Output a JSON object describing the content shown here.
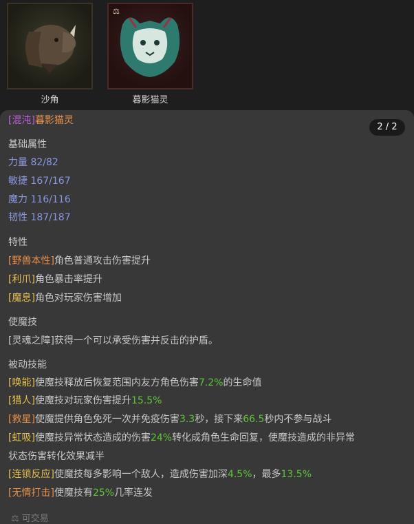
{
  "items": [
    {
      "name": "沙角"
    },
    {
      "name": "暮影猫灵"
    }
  ],
  "tooltip": {
    "tag": "[混沌]",
    "title": "暮影猫灵",
    "counter": "2 / 2",
    "base_header": "基础属性",
    "stats": [
      {
        "label": "力量",
        "value": "82/82"
      },
      {
        "label": "敏捷",
        "value": "167/167"
      },
      {
        "label": "魔力",
        "value": "116/116"
      },
      {
        "label": "韧性",
        "value": "187/187"
      }
    ],
    "trait_header": "特性",
    "traits": [
      {
        "tag": "[野兽本性]",
        "text": "角色普通攻击伤害提升"
      },
      {
        "tag": "[利爪]",
        "text": "角色暴击率提升"
      },
      {
        "tag": "[魔息]",
        "text": "角色对玩家伤害增加"
      }
    ],
    "skill_header": "使魔技",
    "skill_text": "[灵魂之障]获得一个可以承受伤害并反击的护盾。",
    "passive_header": "被动技能",
    "passives": {
      "p1": {
        "tag": "[唤能]",
        "a": "使魔技释放后恢复范围内友方角色伤害",
        "v1": "7.2%",
        "b": "的生命值"
      },
      "p2": {
        "tag": "[猎人]",
        "a": "使魔技对玩家伤害提升",
        "v1": "15.5%"
      },
      "p3": {
        "tag": "[救星]",
        "a": "使魔提供角色免死一次并免疫伤害",
        "v1": "3.3",
        "b": "秒，接下来",
        "v2": "66.5",
        "c": "秒内不参与战斗"
      },
      "p4": {
        "tag": "[虹吸]",
        "a": "使魔技异常状态造成的伤害",
        "v1": "24%",
        "b": "转化成角色生命回复，使魔技造成的非异常",
        "c": "状态伤害转化效果减半"
      },
      "p5": {
        "tag": "[连锁反应]",
        "a": "使魔技每多影响一个敌人，造成伤害加深",
        "v1": "4.5%",
        "b": "，最多",
        "v2": "13.5%"
      },
      "p6": {
        "tag": "[无情打击]",
        "a": "使魔技有",
        "v1": "25%",
        "b": "几率连发"
      }
    },
    "footer": "可交易"
  },
  "colors": {
    "chaos": "#c060e0",
    "title": "#e8904a",
    "trait": "#e6c050",
    "stat": "#8a98e0",
    "number": "#5fc43a",
    "text": "#c8c8c8"
  }
}
